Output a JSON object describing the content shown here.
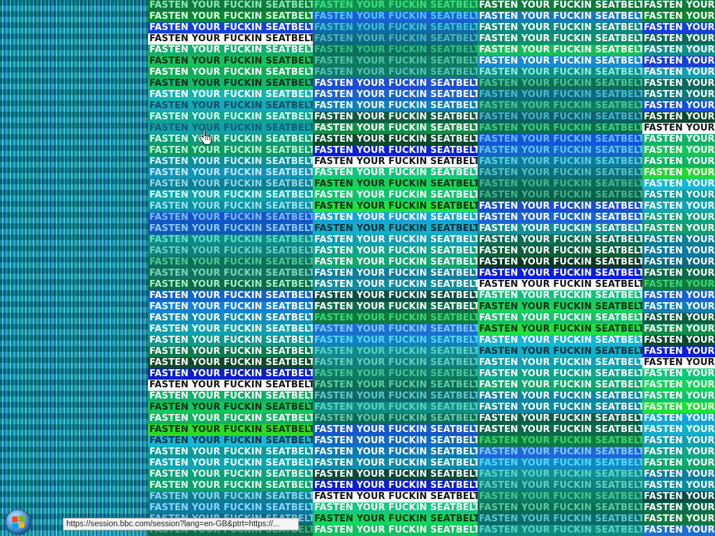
{
  "tile_text": "FASTEN YOUR FUCKIN SEATBELTS",
  "status_bar": {
    "url": "https://session.bbc.com/session?lang=en-GB&ptrt=https://..."
  },
  "taskbar": {
    "start_icon": "windows-start-orb"
  },
  "columns": [
    {
      "rows": [
        [
          "#0f7a3e",
          "#8fe8b0"
        ],
        [
          "#0a8a2e",
          "#d8ffe8"
        ],
        [
          "#1540d8",
          "#ffffff"
        ],
        [
          "#ffffff",
          "#101010"
        ],
        [
          "#11b06a",
          "#ffffff"
        ],
        [
          "#18c25a",
          "#0b2a1a"
        ],
        [
          "#0fae57",
          "#ffffff"
        ],
        [
          "#10b96a",
          "#0b2a1a"
        ],
        [
          "#12b5b0",
          "#ffffff"
        ],
        [
          "#18a7b8",
          "#0e4f63"
        ],
        [
          "#0fa493",
          "#d8fff2"
        ],
        [
          "#13a0a8",
          "#0f5f70"
        ],
        [
          "#0f9a77",
          "#d9fff0"
        ],
        [
          "#0b9b62",
          "#bff5d6"
        ],
        [
          "#118d9b",
          "#cff6ff"
        ],
        [
          "#1193b8",
          "#bdeaff"
        ],
        [
          "#0e7f93",
          "#94d7e8"
        ],
        [
          "#13a2a8",
          "#d6ffff"
        ],
        [
          "#0d8ea4",
          "#9ae3ef"
        ],
        [
          "#1156c8",
          "#7fb8ff"
        ],
        [
          "#1159b8",
          "#8cc8ff"
        ],
        [
          "#108a87",
          "#5ee1cf"
        ],
        [
          "#0f7f7a",
          "#6bd1c4"
        ],
        [
          "#0b6f58",
          "#4fc79d"
        ],
        [
          "#0f7360",
          "#7dd5b5"
        ],
        [
          "#0d6a4a",
          "#a2f0c6"
        ],
        [
          "#1464c8",
          "#ffffff"
        ],
        [
          "#1281d5",
          "#ffffff"
        ],
        [
          "#118fb5",
          "#ffffff"
        ],
        [
          "#10a1b0",
          "#ffffff"
        ],
        [
          "#0e9a8a",
          "#ffffff"
        ],
        [
          "#0b7a4e",
          "#ffffff"
        ],
        [
          "#0f4a28",
          "#ffffff"
        ],
        [
          "#0d1fc8",
          "#ffffff"
        ],
        [
          "#ffffff",
          "#111111"
        ],
        [
          "#11b06a",
          "#ffffff"
        ],
        [
          "#16c45a",
          "#0b2a1a"
        ],
        [
          "#10b35f",
          "#ffffff"
        ],
        [
          "#2bdc24",
          "#0b2a1a"
        ],
        [
          "#13b8d6",
          "#0e2a3a"
        ],
        [
          "#0f9a9a",
          "#eaffff"
        ],
        [
          "#10a5b2",
          "#f0ffff"
        ],
        [
          "#0fa07f",
          "#eaffee"
        ],
        [
          "#10a06d",
          "#dfffea"
        ],
        [
          "#0e7d93",
          "#88d7ee"
        ],
        [
          "#0e79a0",
          "#8ad8ff"
        ],
        [
          "#0b6a80",
          "#74c6e2"
        ],
        [
          "#0d6a4a",
          "#3fb383"
        ]
      ]
    },
    {
      "rows": [
        [
          "#0f8f4f",
          "#3be07a"
        ],
        [
          "#1b5fd6",
          "#4dc8ff"
        ],
        [
          "#116aa6",
          "#3ec3dd"
        ],
        [
          "#0e6a80",
          "#4cb3c8"
        ],
        [
          "#0c6f5a",
          "#30c08a"
        ],
        [
          "#0d7a61",
          "#52c3a3"
        ],
        [
          "#0e7a6a",
          "#57c2b5"
        ],
        [
          "#1d4fd3",
          "#ffffff"
        ],
        [
          "#1a63cf",
          "#ffffff"
        ],
        [
          "#127fb3",
          "#eaffff"
        ],
        [
          "#0e5c40",
          "#ffffff"
        ],
        [
          "#0d8f48",
          "#ffffff"
        ],
        [
          "#0a4a2a",
          "#ffffff"
        ],
        [
          "#0b1fd8",
          "#ffffff"
        ],
        [
          "#ffffff",
          "#111111"
        ],
        [
          "#10c67a",
          "#ffffff"
        ],
        [
          "#15d45a",
          "#0b2a1a"
        ],
        [
          "#11c26c",
          "#ffffff"
        ],
        [
          "#1ee23a",
          "#0b2a1a"
        ],
        [
          "#13a5d8",
          "#ffffff"
        ],
        [
          "#12b0c8",
          "#0e2a3a"
        ],
        [
          "#10a0b2",
          "#ffffff"
        ],
        [
          "#11a58a",
          "#ffffff"
        ],
        [
          "#10a76d",
          "#ffffff"
        ],
        [
          "#0f7fa0",
          "#ffffff"
        ],
        [
          "#0e8da0",
          "#ffffff"
        ],
        [
          "#0c4f46",
          "#ffffff"
        ],
        [
          "#0e6e4a",
          "#ffffff"
        ],
        [
          "#0f7a3e",
          "#3bd57a"
        ],
        [
          "#1a6fd0",
          "#7ec8ff"
        ],
        [
          "#1180c0",
          "#58d4ff"
        ],
        [
          "#0f8a90",
          "#5fd0d0"
        ],
        [
          "#0e7f7a",
          "#66cfc0"
        ],
        [
          "#0d7a61",
          "#46c59d"
        ],
        [
          "#0c6b57",
          "#5cd0a3"
        ],
        [
          "#0d6a6a",
          "#61c7c7"
        ],
        [
          "#0c8e84",
          "#5ed0c2"
        ],
        [
          "#0c6a58",
          "#6bcaa8"
        ],
        [
          "#1558c8",
          "#ffffff"
        ],
        [
          "#116bc2",
          "#ffffff"
        ],
        [
          "#0d7bb3",
          "#ffffff"
        ],
        [
          "#0e8da8",
          "#ffffff"
        ],
        [
          "#0c4a3a",
          "#ffffff"
        ],
        [
          "#0d1fc8",
          "#ffffff"
        ],
        [
          "#ffffff",
          "#111111"
        ],
        [
          "#12c880",
          "#ffffff"
        ],
        [
          "#11d85a",
          "#0b2a1a"
        ],
        [
          "#10c15f",
          "#ffffff"
        ]
      ]
    },
    {
      "rows": [
        [
          "#0f7a3e",
          "#ffffff"
        ],
        [
          "#1479c4",
          "#ffffff"
        ],
        [
          "#0d8a80",
          "#ffffff"
        ],
        [
          "#0f8f6f",
          "#ffffff"
        ],
        [
          "#13bf55",
          "#ffffff"
        ],
        [
          "#1a8ad0",
          "#ffffff"
        ],
        [
          "#0f8e86",
          "#8cefe0"
        ],
        [
          "#0d6f57",
          "#4cc59a"
        ],
        [
          "#0c6a7a",
          "#4cb8cc"
        ],
        [
          "#0d7a61",
          "#48c49a"
        ],
        [
          "#0e5f6a",
          "#45b7c4"
        ],
        [
          "#0e6d4e",
          "#3bd07f"
        ],
        [
          "#1156d8",
          "#6ab8ff"
        ],
        [
          "#1365c8",
          "#66c2ff"
        ],
        [
          "#0d7b98",
          "#5ccfe6"
        ],
        [
          "#0e6f78",
          "#52c3c9"
        ],
        [
          "#0c6a58",
          "#40b88e"
        ],
        [
          "#0c5f4a",
          "#42b590"
        ],
        [
          "#1a4fcf",
          "#ffffff"
        ],
        [
          "#1a65cf",
          "#ffffff"
        ],
        [
          "#0f8f9a",
          "#ffffff"
        ],
        [
          "#0e6b52",
          "#ffffff"
        ],
        [
          "#0d5f3a",
          "#ffffff"
        ],
        [
          "#0a3a22",
          "#ffffff"
        ],
        [
          "#0b1fd8",
          "#ffffff"
        ],
        [
          "#ffffff",
          "#111111"
        ],
        [
          "#12c07a",
          "#ffffff"
        ],
        [
          "#17d25a",
          "#0b2a1a"
        ],
        [
          "#12c269",
          "#ffffff"
        ],
        [
          "#1fe040",
          "#0b2a1a"
        ],
        [
          "#14b5d6",
          "#ffffff"
        ],
        [
          "#10b0c8",
          "#0e2a3a"
        ],
        [
          "#0fa2b2",
          "#ffffff"
        ],
        [
          "#10a58a",
          "#ffffff"
        ],
        [
          "#10a76d",
          "#ffffff"
        ],
        [
          "#0f86a6",
          "#ffffff"
        ],
        [
          "#0e8aa0",
          "#ffffff"
        ],
        [
          "#0c5f4a",
          "#ffffff"
        ],
        [
          "#0d6a4a",
          "#ffffff"
        ],
        [
          "#0f7a3e",
          "#3bd57a"
        ],
        [
          "#1f66d8",
          "#7fc8ff"
        ],
        [
          "#0f8bc2",
          "#58d4ff"
        ],
        [
          "#0f8f8f",
          "#5ed2d2"
        ],
        [
          "#0e7f7a",
          "#62d0c1"
        ],
        [
          "#0d7a61",
          "#45c59d"
        ],
        [
          "#0c6b57",
          "#57cf9f"
        ],
        [
          "#0d6a6a",
          "#5ac6c6"
        ],
        [
          "#0c8a80",
          "#5ed0c2"
        ]
      ]
    },
    {
      "rows": [
        [
          "#0f7a3e",
          "#ffffff"
        ],
        [
          "#0a8a2e",
          "#ffffff"
        ],
        [
          "#1540d8",
          "#ffffff"
        ],
        [
          "#0e6a5a",
          "#ffffff"
        ],
        [
          "#0f8f8a",
          "#ffffff"
        ],
        [
          "#1a3fd0",
          "#ffffff"
        ],
        [
          "#12a0b0",
          "#ffffff"
        ],
        [
          "#0e6a5a",
          "#ffffff"
        ],
        [
          "#0e7a7a",
          "#ffffff"
        ],
        [
          "#1451d8",
          "#ffffff"
        ],
        [
          "#0b4a2e",
          "#ffffff"
        ],
        [
          "#ffffff",
          "#111111"
        ],
        [
          "#10b06a",
          "#ffffff"
        ],
        [
          "#17c45a",
          "#ffffff"
        ],
        [
          "#10b35f",
          "#ffffff"
        ],
        [
          "#25d830",
          "#ffffff"
        ],
        [
          "#14b8d6",
          "#ffffff"
        ],
        [
          "#0f9a9a",
          "#ffffff"
        ],
        [
          "#10a5b2",
          "#ffffff"
        ],
        [
          "#0fa07f",
          "#ffffff"
        ],
        [
          "#10a06d",
          "#ffffff"
        ],
        [
          "#0e7d93",
          "#ffffff"
        ],
        [
          "#0e79a0",
          "#ffffff"
        ],
        [
          "#0b6a80",
          "#ffffff"
        ],
        [
          "#0d6a4a",
          "#ffffff"
        ],
        [
          "#0f7a3e",
          "#3bd57a"
        ],
        [
          "#1a63cf",
          "#ffffff"
        ],
        [
          "#127fb3",
          "#ffffff"
        ],
        [
          "#0e5c40",
          "#ffffff"
        ],
        [
          "#0d8f48",
          "#ffffff"
        ],
        [
          "#0a4a2a",
          "#ffffff"
        ],
        [
          "#0b1fd8",
          "#ffffff"
        ],
        [
          "#ffffff",
          "#111111"
        ],
        [
          "#10c67a",
          "#ffffff"
        ],
        [
          "#15d45a",
          "#ffffff"
        ],
        [
          "#11c26c",
          "#ffffff"
        ],
        [
          "#1ee23a",
          "#ffffff"
        ],
        [
          "#13a5d8",
          "#ffffff"
        ],
        [
          "#12b0c8",
          "#ffffff"
        ],
        [
          "#10a0b2",
          "#ffffff"
        ],
        [
          "#11a58a",
          "#ffffff"
        ],
        [
          "#10a76d",
          "#ffffff"
        ],
        [
          "#0f7fa0",
          "#ffffff"
        ],
        [
          "#0e8da0",
          "#ffffff"
        ],
        [
          "#0c4f46",
          "#ffffff"
        ],
        [
          "#0e6e4a",
          "#ffffff"
        ],
        [
          "#0f7a3e",
          "#ffffff"
        ],
        [
          "#1a6fd0",
          "#ffffff"
        ]
      ]
    }
  ],
  "icons": {
    "cursor": "hand-pointer-icon",
    "start": "windows-logo-icon"
  }
}
